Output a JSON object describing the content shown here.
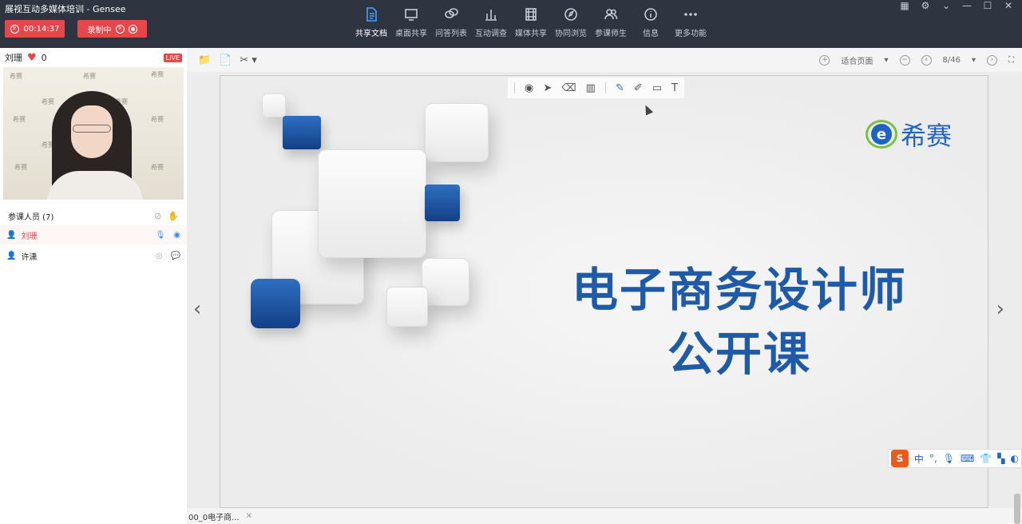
{
  "app": {
    "title": "展视互动多媒体培训  - Gensee"
  },
  "controls": {
    "timer": "00:14:37",
    "recording": "录制中"
  },
  "nav": [
    {
      "label": "共享文档",
      "icon": "document-icon"
    },
    {
      "label": "桌面共享",
      "icon": "monitor-icon"
    },
    {
      "label": "问答列表",
      "icon": "chat-bubbles-icon"
    },
    {
      "label": "互动调查",
      "icon": "bar-chart-icon"
    },
    {
      "label": "媒体共享",
      "icon": "film-icon"
    },
    {
      "label": "协同浏览",
      "icon": "compass-icon"
    },
    {
      "label": "参课师生",
      "icon": "users-icon"
    },
    {
      "label": "信息",
      "icon": "info-icon"
    },
    {
      "label": "更多功能",
      "icon": "more-dots-icon"
    }
  ],
  "host": {
    "name": "刘珊",
    "likes": "0",
    "live": "LIVE"
  },
  "video": {
    "watermark": "希赛"
  },
  "members": {
    "header": "参课人员 (7)",
    "list": [
      {
        "name": "刘珊"
      },
      {
        "name": "许潇"
      }
    ]
  },
  "doc": {
    "zoom": "适合页面",
    "page": "8/46"
  },
  "slide": {
    "logo_text": "希赛",
    "logo_mark": "e",
    "title_line1": "电子商务设计师",
    "title_line2": "公开课"
  },
  "ime": {
    "logo": "S",
    "lang": "中"
  },
  "tab": {
    "name": "00_0电子商..."
  },
  "colors": {
    "accent": "#e5474b",
    "brand_blue": "#1f5aa8",
    "topbar": "#2e3440"
  }
}
